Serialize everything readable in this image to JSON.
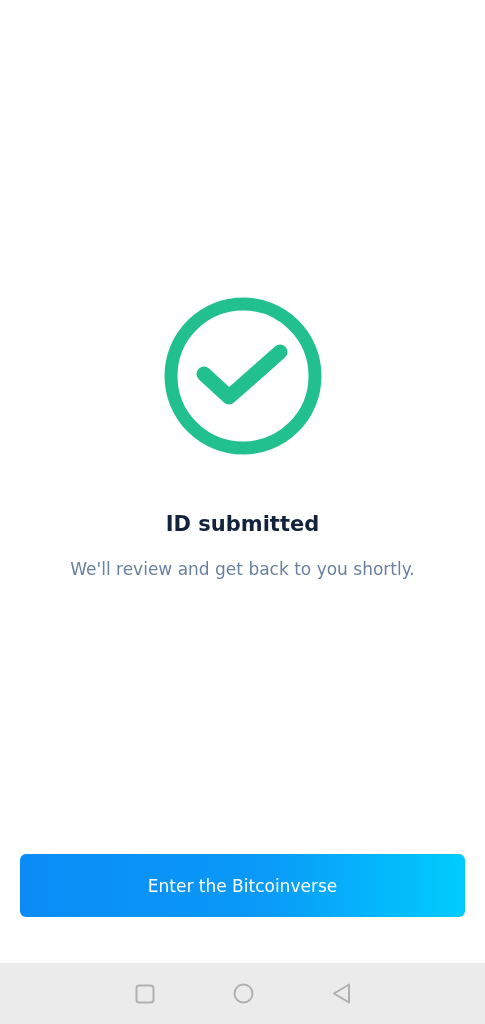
{
  "title": "ID submitted",
  "message": "We'll review and get back to you shortly.",
  "button": {
    "label": "Enter the Bitcoinverse"
  }
}
